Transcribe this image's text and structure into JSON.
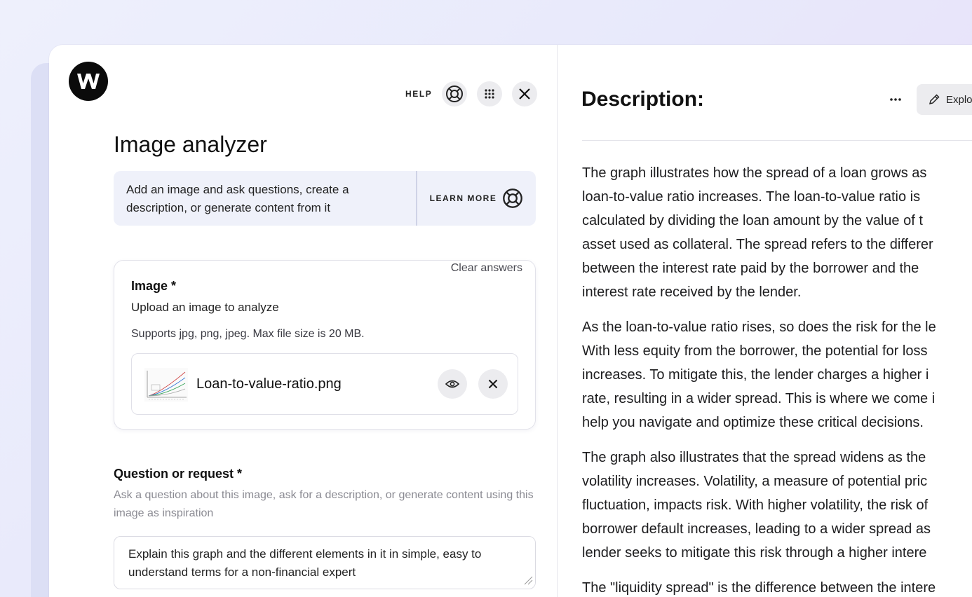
{
  "left_panel": {
    "help_label": "HELP",
    "title": "Image analyzer",
    "info_text": "Add an image and ask questions, create a description, or generate content from it",
    "learn_more_label": "LEARN MORE",
    "image_section": {
      "clear_answers_label": "Clear answers",
      "label": "Image *",
      "subtitle": "Upload an image to analyze",
      "hint": "Supports jpg, png, jpeg. Max file size is 20 MB.",
      "file_name": "Loan-to-value-ratio.png"
    },
    "question_section": {
      "label": "Question or request *",
      "hint": "Ask a question about this image, ask for a description, or generate content using this image as inspiration",
      "value": "Explain this graph and the different elements in it in simple, easy to understand terms for a non-financial expert"
    }
  },
  "right_panel": {
    "title": "Description:",
    "explore_label": "Explore",
    "paragraphs": [
      [
        "The graph illustrates how the spread of a loan grows as",
        "loan-to-value ratio increases. The loan-to-value ratio is",
        "calculated by dividing the loan amount by the value of t",
        "asset used as collateral. The spread refers to the differer",
        "between the interest rate paid by the borrower and the",
        "interest rate received by the lender."
      ],
      [
        "As the loan-to-value ratio rises, so does the risk for the le",
        "With less equity from the borrower, the potential for loss",
        "increases. To mitigate this, the lender charges a higher i",
        "rate, resulting in a wider spread. This is where we come i",
        "help you navigate and optimize these critical decisions."
      ],
      [
        "The graph also illustrates that the spread widens as the",
        "volatility increases. Volatility, a measure of potential pric",
        "fluctuation, impacts risk. With higher volatility, the risk of",
        "borrower default increases, leading to a wider spread as",
        "lender seeks to mitigate this risk through a higher intere"
      ],
      [
        "The \"liquidity spread\" is the difference between the intere"
      ]
    ]
  },
  "colors": {
    "background": "#eceefb",
    "info_box": "#eff1fa",
    "button_bg": "#ececef",
    "text": "#1d1d1f",
    "muted_text": "#8a8a92"
  },
  "icons": {
    "logo": "w-logo",
    "help": "lifebuoy-icon",
    "apps": "grid-icon",
    "close": "close-icon",
    "learn_more": "lifebuoy-icon",
    "preview": "eye-icon",
    "remove": "close-icon",
    "more": "more-icon",
    "explore": "pencil-icon"
  }
}
